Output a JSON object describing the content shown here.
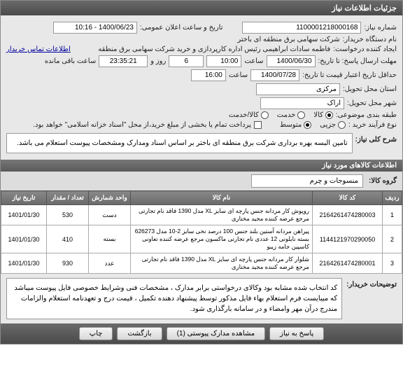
{
  "header": {
    "title": "جزئیات اطلاعات نیاز"
  },
  "fields": {
    "need_no_label": "شماره نیاز:",
    "need_no": "1100001218000168",
    "announce_label": "تاریخ و ساعت اعلان عمومی:",
    "announce_value": "1400/06/23 - 10:16",
    "buyer_org_label": "نام دستگاه خریدار:",
    "buyer_org": "شرکت سهامی برق منطقه ای باختر",
    "creator_label": "ایجاد کننده درخواست:",
    "creator": "فاطمه سادات ابراهیمی رئیس اداره کارپردازی و خرید شرکت سهامی برق منطقه",
    "contact_link": "اطلاعات تماس خریدار",
    "deadline_label": "مهلت ارسال پاسخ: تا تاریخ:",
    "deadline_date": "1400/06/30",
    "saat": "ساعت",
    "deadline_time": "10:00",
    "remain_days": "6",
    "remain_days_label": "روز و",
    "remain_time": "23:35:21",
    "remain_suffix": "ساعت باقی مانده",
    "validity_label": "حداقل تاریخ اعتبار قیمت تا تاریخ:",
    "validity_date": "1400/07/28",
    "validity_time": "16:00",
    "province_label": "استان محل تحویل:",
    "province": "مرکزی",
    "city_label": "شهر محل تحویل:",
    "city": "اراک",
    "topic_class_label": "طبقه بندی موضوعی:",
    "topic_goods": "کالا",
    "topic_service": "خدمت",
    "topic_both": "کالا/خدمت",
    "process_label": "نوع فرآیند خرید :",
    "process_low": "جزیی",
    "process_mid": "متوسط",
    "payment_checkbox_label": "پرداخت تمام یا بخشی از مبلغ خرید،از محل \"اسناد خزانه اسلامی\" خواهد بود.",
    "desc_label": "شرح کلی نیاز:",
    "desc": "تامین البسه بهره برداری شرکت برق منطقه ای باختر بر اساس اسناد ومدارک ومشخصات پیوست استعلام می باشد.",
    "items_header": "اطلاعات کالاهای مورد نیاز",
    "group_label": "گروه کالا:",
    "group_value": "منسوجات و چرم"
  },
  "table": {
    "headers": [
      "ردیف",
      "کد کالا",
      "نام کالا",
      "واحد شمارش",
      "تعداد / مقدار",
      "تاریخ نیاز"
    ],
    "rows": [
      {
        "idx": "1",
        "code": "2164261474280003",
        "name": "روپوش کار مردانه جنس پارچه ای سایز XL مدل 1390 فاقد نام تجارتی مرجع عرضه کننده مجید مختاری",
        "unit": "دست",
        "qty": "530",
        "date": "1401/01/30"
      },
      {
        "idx": "2",
        "code": "1144121970290050",
        "name": "پیراهن مردانه آستین بلند جنس 100 درصد نخی سایز 2-10 مدل 626273 بسته نایلونی 12 عددی نام تجارتی ماکسون مرجع عرضه کننده تعاونی کاسپین جامه زیبو",
        "unit": "بسته",
        "qty": "410",
        "date": "1401/01/30"
      },
      {
        "idx": "3",
        "code": "2164261474280001",
        "name": "شلوار کار مردانه جنس پارچه ای سایز XL مدل 1390 فاقد نام تجارتی مرجع عرضه کننده مجید مختاری",
        "unit": "عدد",
        "qty": "930",
        "date": "1401/01/30"
      }
    ]
  },
  "footer": {
    "desc_label": "توضیحات خریدار:",
    "desc": "کد انتخاب شده مشابه بود وکالای درخواستی برابر مدارک ، مشخصات فنی وشرایط خصوصی فایل پیوست میباشد که میبایست فرم استعلام بهاء فایل مذکور توسط پیشنهاد دهنده تکمیل ، قیمت درج و تعهدنامه استعلام والزامات  مندرج درآن مهر وامضاء و در سامانه بارگذاری شود."
  },
  "buttons": {
    "reply": "پاسخ به نیاز",
    "attach": "مشاهده مدارک پیوستی (1)",
    "back": "بازگشت",
    "print": "چاپ"
  }
}
